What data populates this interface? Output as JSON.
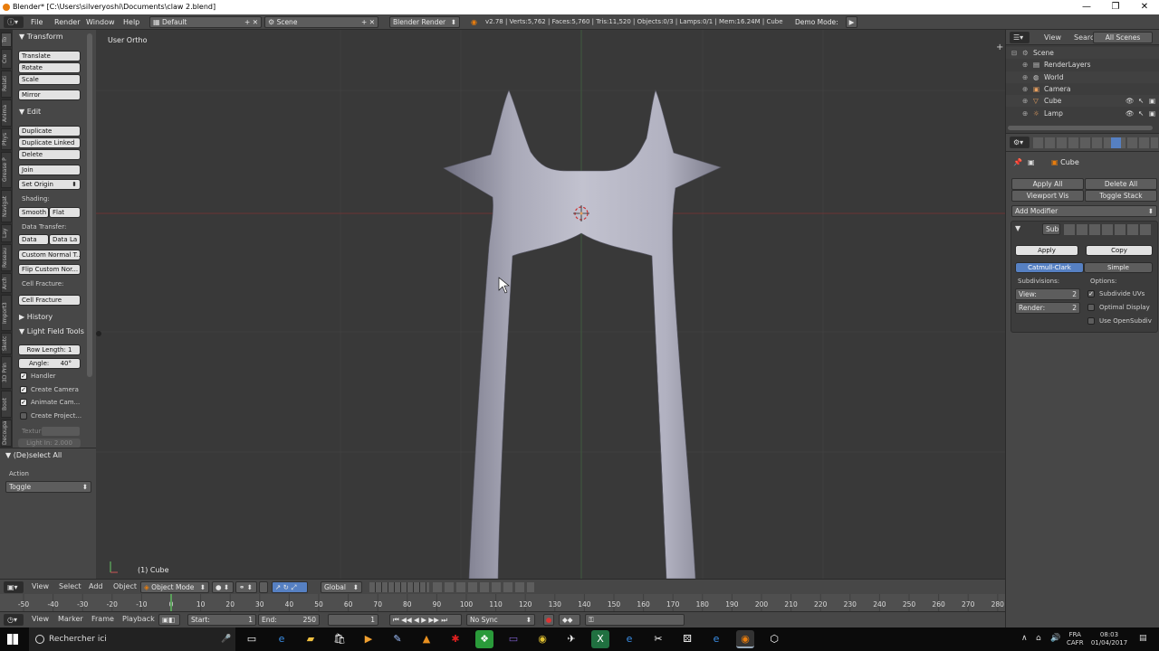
{
  "window": {
    "title": "Blender* [C:\\Users\\silveryoshi\\Documents\\claw 2.blend]",
    "minimize": "—",
    "maximize": "❐",
    "close": "✕"
  },
  "infobar": {
    "menus": [
      "File",
      "Render",
      "Window",
      "Help"
    ],
    "layout": "Default",
    "scene": "Scene",
    "engine": "Blender Render",
    "stats": "v2.78 | Verts:5,762 | Faces:5,760 | Tris:11,520 | Objects:0/3 | Lamps:0/1 | Mem:16.24M | Cube",
    "demo_mode": "Demo Mode:"
  },
  "tool_tabs": [
    "To",
    "Cre",
    "Relati",
    "Anima",
    "Phys",
    "Grease P",
    "Navigat",
    "Lay",
    "Reseau",
    "Arch",
    "Import3",
    "Sketc",
    "3D Prin",
    "Boot",
    "Decoupa"
  ],
  "toolshelf": {
    "transform": {
      "title": "Transform",
      "buttons": [
        "Translate",
        "Rotate",
        "Scale",
        "Mirror"
      ]
    },
    "edit": {
      "title": "Edit",
      "buttons": [
        "Duplicate",
        "Duplicate Linked",
        "Delete",
        "Join"
      ],
      "set_origin": "Set Origin",
      "shading_label": "Shading:",
      "smooth": "Smooth",
      "flat": "Flat",
      "data_transfer_label": "Data Transfer:",
      "data": "Data",
      "data_layout": "Data La",
      "custom_normal": "Custom Normal T...",
      "flip_custom": "Flip Custom Nor...",
      "cell_fracture_label": "Cell Fracture:",
      "cell_fracture": "Cell Fracture"
    },
    "history": {
      "title": "History"
    },
    "light_field": {
      "title": "Light Field Tools",
      "row_length": "Row Length: 1",
      "angle_label": "Angle:",
      "angle_value": "40°",
      "handler": "Handler",
      "create_camera": "Create Camera",
      "animate_camera": "Animate Cam...",
      "create_projector": "Create Project...",
      "textur": "Textur",
      "light_in": "Light In: 2.000"
    }
  },
  "operator": {
    "title": "(De)select All",
    "action_label": "Action",
    "action_value": "Toggle"
  },
  "viewport": {
    "view_label": "User Ortho",
    "object_label": "(1) Cube"
  },
  "viewport_header": {
    "menus": [
      "View",
      "Select",
      "Add",
      "Object"
    ],
    "mode": "Object Mode",
    "orientation": "Global"
  },
  "timeline": {
    "ticks": [
      "-50",
      "-40",
      "-30",
      "-20",
      "-10",
      "0",
      "10",
      "20",
      "30",
      "40",
      "50",
      "60",
      "70",
      "80",
      "90",
      "100",
      "110",
      "120",
      "130",
      "140",
      "150",
      "160",
      "170",
      "180",
      "190",
      "200",
      "210",
      "220",
      "230",
      "240",
      "250",
      "260",
      "270",
      "280"
    ],
    "current_frame_value": 0
  },
  "timeline_header": {
    "menus": [
      "View",
      "Marker",
      "Frame",
      "Playback"
    ],
    "start": "Start:",
    "start_value": "1",
    "end": "End:",
    "end_value": "250",
    "current": "1",
    "sync": "No Sync"
  },
  "outliner": {
    "menus": [
      "View",
      "Search"
    ],
    "filter": "All Scenes",
    "items": [
      {
        "label": "Scene",
        "indent": 0,
        "icon": "scene-icon"
      },
      {
        "label": "RenderLayers",
        "indent": 1,
        "icon": "renderlayers-icon"
      },
      {
        "label": "World",
        "indent": 1,
        "icon": "world-icon"
      },
      {
        "label": "Camera",
        "indent": 1,
        "icon": "camera-icon"
      },
      {
        "label": "Cube",
        "indent": 1,
        "icon": "mesh-icon"
      },
      {
        "label": "Lamp",
        "indent": 1,
        "icon": "lamp-icon"
      }
    ]
  },
  "properties": {
    "object": "Cube",
    "apply_all": "Apply All",
    "delete_all": "Delete All",
    "viewport_vis": "Viewport Vis",
    "toggle_stack": "Toggle Stack",
    "add_modifier": "Add Modifier",
    "modifier_name": "Sub",
    "apply": "Apply",
    "copy": "Copy",
    "catmull": "Catmull-Clark",
    "simple": "Simple",
    "subdivisions_label": "Subdivisions:",
    "options_label": "Options:",
    "view_field": "View:",
    "view_value": "2",
    "render_field": "Render:",
    "render_value": "2",
    "subdivide_uvs": "Subdivide UVs",
    "optimal_display": "Optimal Display",
    "use_opensubdiv": "Use OpenSubdiv"
  },
  "taskbar": {
    "search": "Rechercher ici",
    "lang1": "FRA",
    "lang2": "CAFR",
    "time": "08:03",
    "date": "01/04/2017"
  },
  "colors": {
    "accent": "#5680c2",
    "viewport_bg": "#393939",
    "panel_bg": "#474747",
    "blender_orange": "#e87d0d"
  }
}
